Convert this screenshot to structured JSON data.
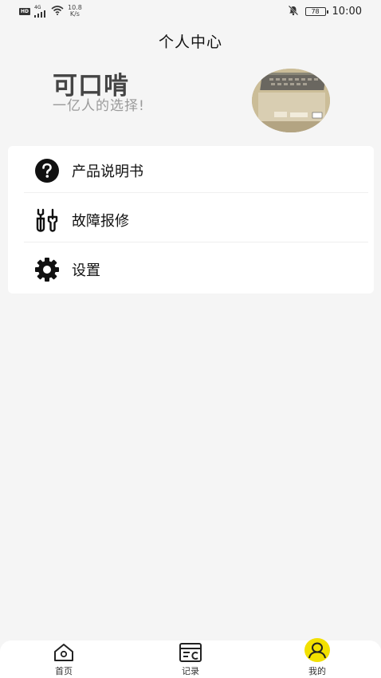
{
  "status_bar": {
    "chip_left": "HD",
    "network": "4G",
    "speed_value": "10.8",
    "speed_unit": "K/s",
    "battery": "78",
    "time": "10:00"
  },
  "header": {
    "title": "个人中心"
  },
  "profile": {
    "brand_name": "可口啃",
    "slogan": "一亿人的选择!"
  },
  "menu": {
    "items": [
      {
        "label": "产品说明书",
        "icon": "question-icon"
      },
      {
        "label": "故障报修",
        "icon": "wrench-icon"
      },
      {
        "label": "设置",
        "icon": "gear-icon"
      }
    ]
  },
  "bottom_nav": {
    "items": [
      {
        "label": "首页",
        "icon": "home-icon"
      },
      {
        "label": "记录",
        "icon": "record-icon"
      },
      {
        "label": "我的",
        "icon": "user-icon",
        "active": true
      }
    ]
  },
  "colors": {
    "accent": "#f2e000",
    "background": "#f5f5f5",
    "card": "#ffffff"
  }
}
